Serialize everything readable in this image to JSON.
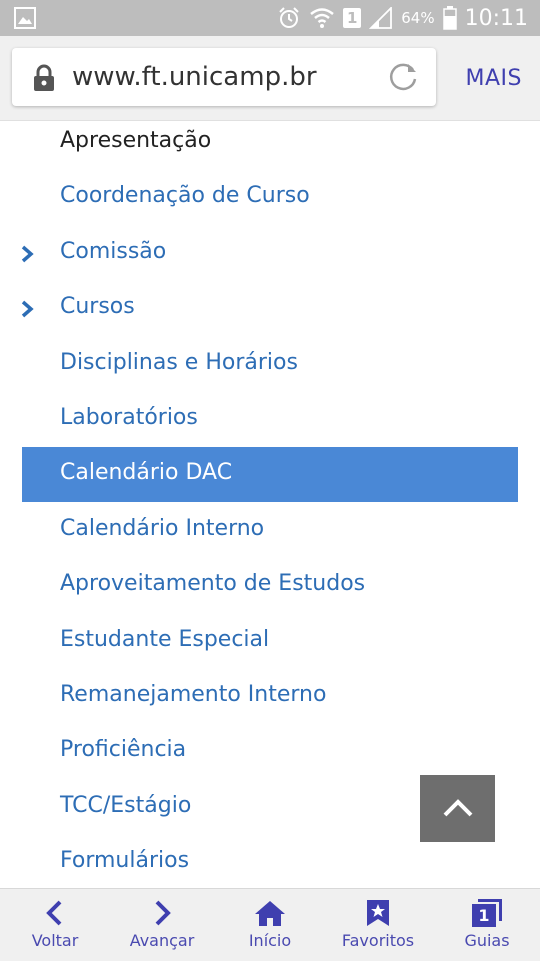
{
  "status_bar": {
    "battery": "64%",
    "sim_slot": "1",
    "time": "10:11",
    "icons": [
      "image-icon",
      "alarm-icon",
      "wifi-icon",
      "sim-icon",
      "signal-icon",
      "battery-icon"
    ]
  },
  "browser": {
    "url": "www.ft.unicamp.br",
    "more_label": "MAIS"
  },
  "menu": {
    "items": [
      {
        "label": "Apresentação",
        "style": "dark",
        "chevron": false
      },
      {
        "label": "Coordenação de Curso",
        "style": "link",
        "chevron": false
      },
      {
        "label": "Comissão",
        "style": "link",
        "chevron": true
      },
      {
        "label": "Cursos",
        "style": "link",
        "chevron": true
      },
      {
        "label": "Disciplinas e Horários",
        "style": "link",
        "chevron": false
      },
      {
        "label": "Laboratórios",
        "style": "link",
        "chevron": false
      },
      {
        "label": "Calendário DAC",
        "style": "active",
        "chevron": false
      },
      {
        "label": "Calendário Interno",
        "style": "link",
        "chevron": false
      },
      {
        "label": "Aproveitamento de Estudos",
        "style": "link",
        "chevron": false
      },
      {
        "label": "Estudante Especial",
        "style": "link",
        "chevron": false
      },
      {
        "label": "Remanejamento Interno",
        "style": "link",
        "chevron": false
      },
      {
        "label": "Proficiência",
        "style": "link",
        "chevron": false
      },
      {
        "label": "TCC/Estágio",
        "style": "link",
        "chevron": false
      },
      {
        "label": "Formulários",
        "style": "link",
        "chevron": false
      }
    ]
  },
  "toolbar": {
    "back": "Voltar",
    "forward": "Avançar",
    "home": "Início",
    "favorites": "Favoritos",
    "tabs": "Guias",
    "tab_count": "1"
  },
  "colors": {
    "link": "#2d6db5",
    "active_bg": "#4a88d6",
    "toolbar_accent": "#3f3faf",
    "status_bar": "#bdbdbd"
  }
}
